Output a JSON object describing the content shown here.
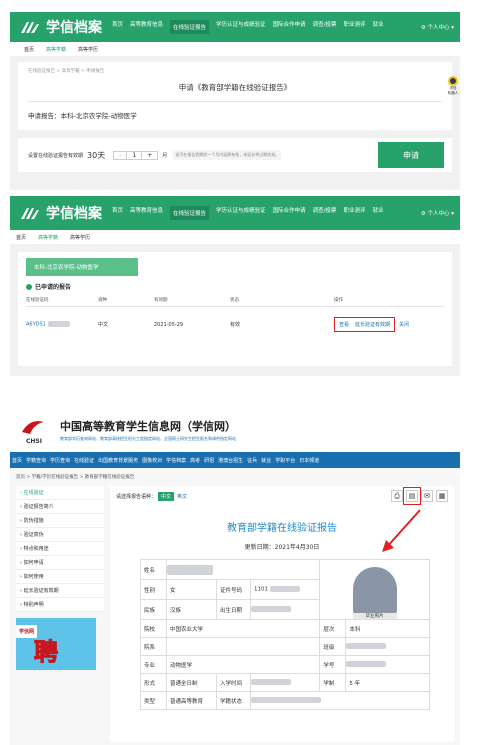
{
  "p1": {
    "brand": "学信档案",
    "nav": [
      "首页",
      "高等教育信息",
      "在线验证报告",
      "学历认证与成绩验证",
      "国际合作申请",
      "调查/投票",
      "职业测评",
      "就业"
    ],
    "nav_active": 2,
    "user_menu": "个人中心",
    "tabs": [
      "高等学籍",
      "高等学历"
    ],
    "breadcrumb": "在线验证报告 > 高等学籍 > 申请报告",
    "title": "申请《教育部学籍在线验证报告》",
    "report_label": "申请报告：本科-北京农学院-动物医学",
    "validity_label": "设置在线验证报告有效期",
    "validity_value": "30天",
    "stepper_minus": "-",
    "stepper_value": "1",
    "stepper_plus": "+",
    "stepper_unit": "月",
    "validity_hint": "该可在报告到期前一个月内延期有效，未延长将过期失效。",
    "apply_button": "申请",
    "side_label": "学信\n机器人"
  },
  "p2": {
    "brand": "学信档案",
    "nav": [
      "首页",
      "高等教育信息",
      "在线验证报告",
      "学历认证与成绩验证",
      "国际合作申请",
      "调查/投票",
      "职业测评",
      "就业"
    ],
    "nav_active": 2,
    "user_menu": "个人中心",
    "tabs": [
      "首页",
      "高等学籍",
      "高等学历"
    ],
    "banner": "本科-北京农学院-动物医学",
    "section_title": "已申请的报告",
    "headers": [
      "在线验证码",
      "语种",
      "有效期",
      "状态",
      "操作"
    ],
    "row": {
      "code": "A6YDS1",
      "lang": "中文",
      "expiry": "2021-05-29",
      "status": "有效",
      "view": "查看",
      "extend": "延长验证有效期",
      "close": "关闭"
    }
  },
  "p3": {
    "site_name": "中国高等教育学生信息网（学信网）",
    "logo_text": "CHSI",
    "slogan": "教育部学历查询网站、教育部高校招生阳光工程指定网站、全国硕士研究生招生报名和调剂指定网站",
    "nav": [
      "首页",
      "学籍查询",
      "学历查询",
      "在线验证",
      "出国教育背景服务",
      "图像校对",
      "学信档案",
      "高考",
      "研招",
      "港澳台招生",
      "征兵",
      "就业",
      "学职平台",
      "日本频道"
    ],
    "breadcrumb": "首页 > 学籍/学历在线验证报告 > 教育部学籍在线验证报告",
    "sidebar": [
      "在线验证",
      "验证报告简介",
      "防伪措施",
      "验证真伪",
      "特点和用途",
      "如何申请",
      "如何使用",
      "延长验证有效期",
      "特别声明"
    ],
    "ad_logo": "学信网",
    "ad_text": "聘",
    "lang_label": "请选择报告语种：",
    "lang_options": [
      "中文",
      "英文"
    ],
    "report_title": "教育部学籍在线验证报告",
    "update_date": "更新日期：2021年4月30日",
    "photo_caption": "毕业照片",
    "fields": {
      "name_label": "姓名",
      "gender_label": "性别",
      "gender_value": "女",
      "id_label": "证件号码",
      "id_value": "1101",
      "ethnic_label": "民族",
      "ethnic_value": "汉族",
      "birth_label": "出生日期",
      "school_label": "院校",
      "school_value": "中国农业大学",
      "level_label": "层次",
      "level_value": "本科",
      "dept_label": "院系",
      "class_label": "班级",
      "major_label": "专业",
      "major_value": "动物医学",
      "stuno_label": "学号",
      "form_label": "形式",
      "form_value": "普通全日制",
      "entry_label": "入学时间",
      "duration_label": "学制",
      "duration_value": "5 年",
      "type_label": "类型",
      "type_value": "普通高等教育",
      "status_label": "学籍状态"
    }
  },
  "colors": {
    "green": "#27a26b",
    "chsi_blue": "#1a6fb0",
    "red_box": "#e02020",
    "report_blue": "#1e8bd0"
  }
}
